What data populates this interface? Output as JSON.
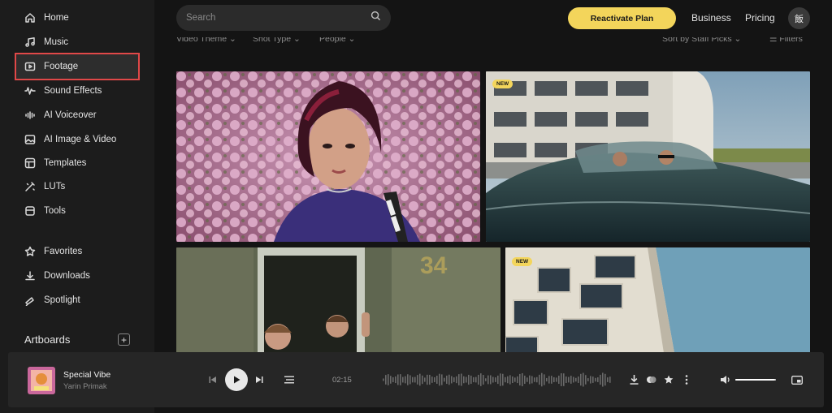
{
  "sidebar": {
    "nav_primary": [
      {
        "label": "Home",
        "icon": "home-icon"
      },
      {
        "label": "Music",
        "icon": "music-note-icon"
      },
      {
        "label": "Footage",
        "icon": "video-play-icon",
        "active": true
      },
      {
        "label": "Sound Effects",
        "icon": "waveform-icon"
      },
      {
        "label": "AI Voiceover",
        "icon": "voice-bars-icon"
      },
      {
        "label": "AI Image & Video",
        "icon": "ai-image-icon"
      },
      {
        "label": "Templates",
        "icon": "template-icon"
      },
      {
        "label": "LUTs",
        "icon": "lut-icon"
      },
      {
        "label": "Tools",
        "icon": "tools-icon"
      }
    ],
    "nav_secondary": [
      {
        "label": "Favorites",
        "icon": "star-icon"
      },
      {
        "label": "Downloads",
        "icon": "download-icon"
      },
      {
        "label": "Spotlight",
        "icon": "spotlight-icon"
      }
    ],
    "artboards_label": "Artboards",
    "artboards_add": "+"
  },
  "header": {
    "search_placeholder": "Search",
    "reactivate_label": "Reactivate Plan",
    "business_label": "Business",
    "pricing_label": "Pricing",
    "avatar_text": "飯"
  },
  "filters": {
    "items": [
      "Video Theme",
      "Shot Type",
      "People"
    ],
    "sort_label": "Sort by Staff Picks",
    "filters_label": "Filters"
  },
  "grid": {
    "items": [
      {
        "badge": ""
      },
      {
        "badge": "NEW"
      },
      {
        "badge": ""
      },
      {
        "badge": "NEW"
      }
    ]
  },
  "player": {
    "title": "Special Vibe",
    "artist": "Yarin Primak",
    "time": "02:15",
    "volume": 0.95
  },
  "colors": {
    "accent": "#f3d55b",
    "highlight_outline": "#e04848",
    "background": "#141414",
    "sidebar": "#1c1c1c"
  }
}
